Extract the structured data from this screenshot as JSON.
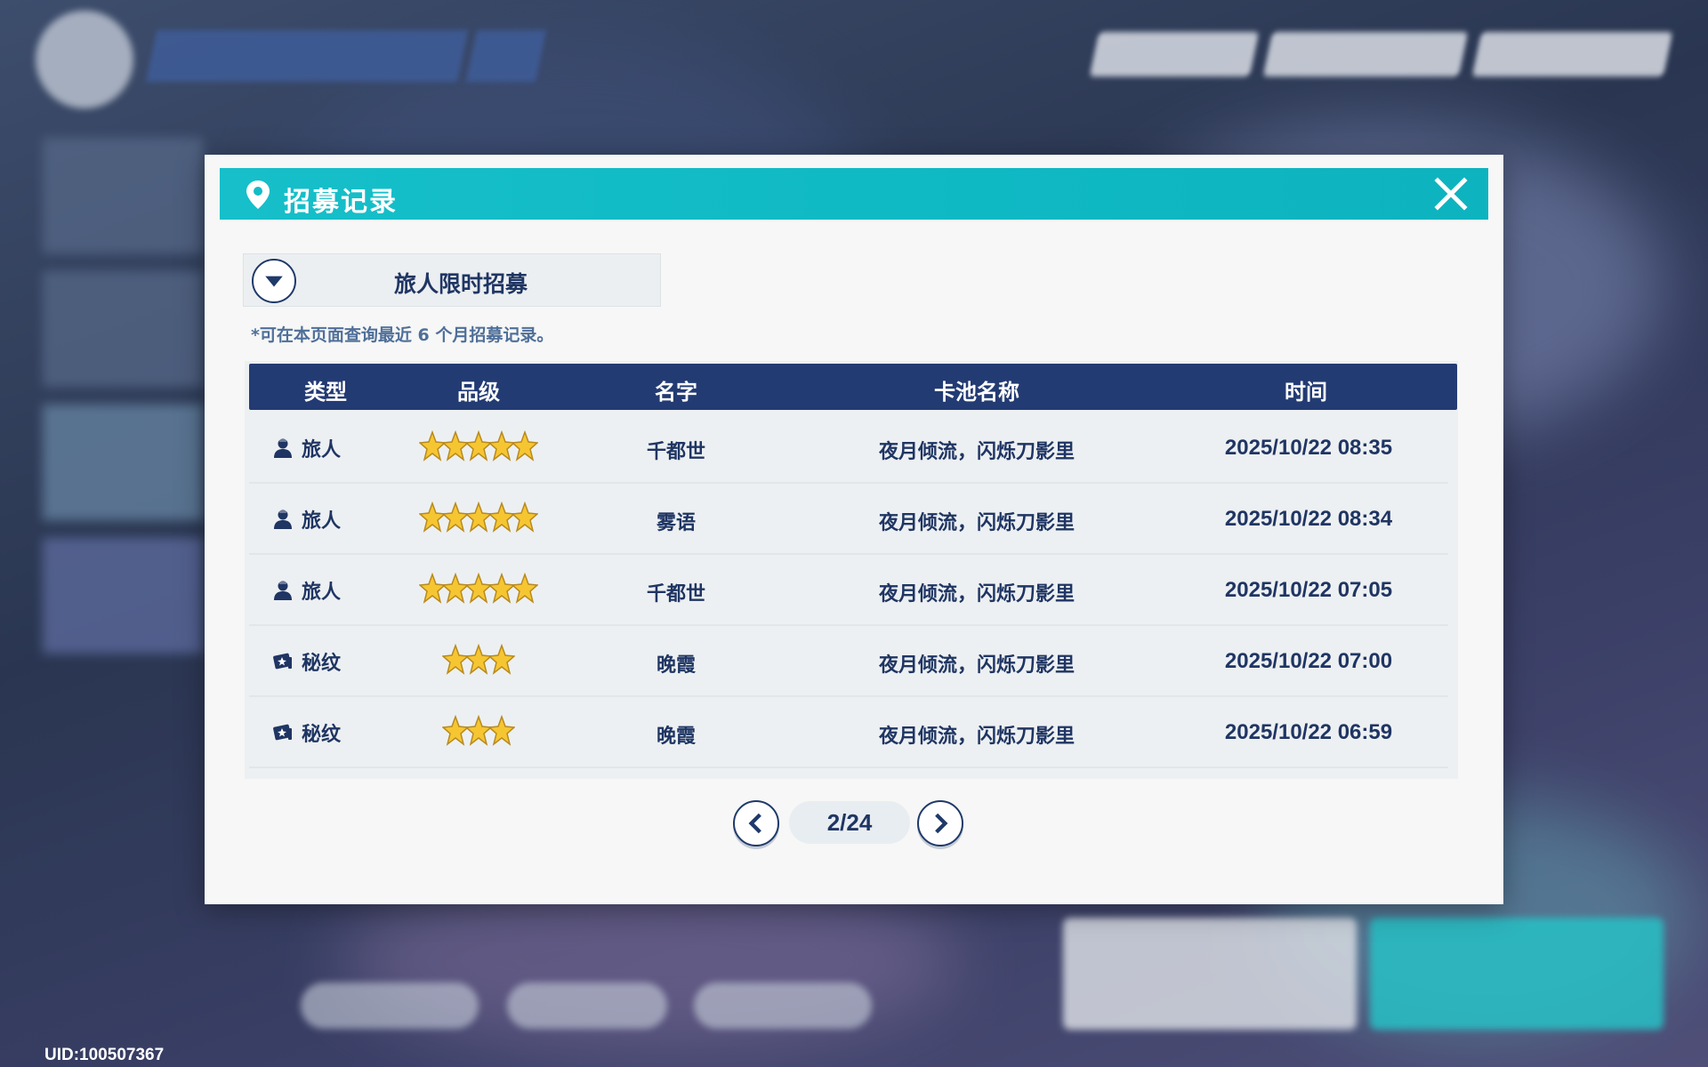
{
  "background": {
    "uid": "UID:100507367"
  },
  "modal": {
    "title": "招募记录",
    "pool_selector": {
      "label": "旅人限时招募"
    },
    "note": "*可在本页面查询最近 6 个月招募记录。",
    "columns": [
      "类型",
      "品级",
      "名字",
      "卡池名称",
      "时间"
    ],
    "rows": [
      {
        "type_icon": "traveler-icon",
        "type": "旅人",
        "stars": 5,
        "name": "千都世",
        "pool": "夜月倾流，闪烁刀影里",
        "time": "2025/10/22 08:35"
      },
      {
        "type_icon": "traveler-icon",
        "type": "旅人",
        "stars": 5,
        "name": "雾语",
        "pool": "夜月倾流，闪烁刀影里",
        "time": "2025/10/22 08:34"
      },
      {
        "type_icon": "traveler-icon",
        "type": "旅人",
        "stars": 5,
        "name": "千都世",
        "pool": "夜月倾流，闪烁刀影里",
        "time": "2025/10/22 07:05"
      },
      {
        "type_icon": "emblem-icon",
        "type": "秘纹",
        "stars": 3,
        "name": "晚霞",
        "pool": "夜月倾流，闪烁刀影里",
        "time": "2025/10/22 07:00"
      },
      {
        "type_icon": "emblem-icon",
        "type": "秘纹",
        "stars": 3,
        "name": "晚霞",
        "pool": "夜月倾流，闪烁刀影里",
        "time": "2025/10/22 06:59"
      }
    ],
    "pager": {
      "page": "2/24"
    }
  },
  "colors": {
    "header": "#14bcc7",
    "table_header": "#233b73",
    "text": "#1f3563",
    "star": "#f6c632"
  }
}
